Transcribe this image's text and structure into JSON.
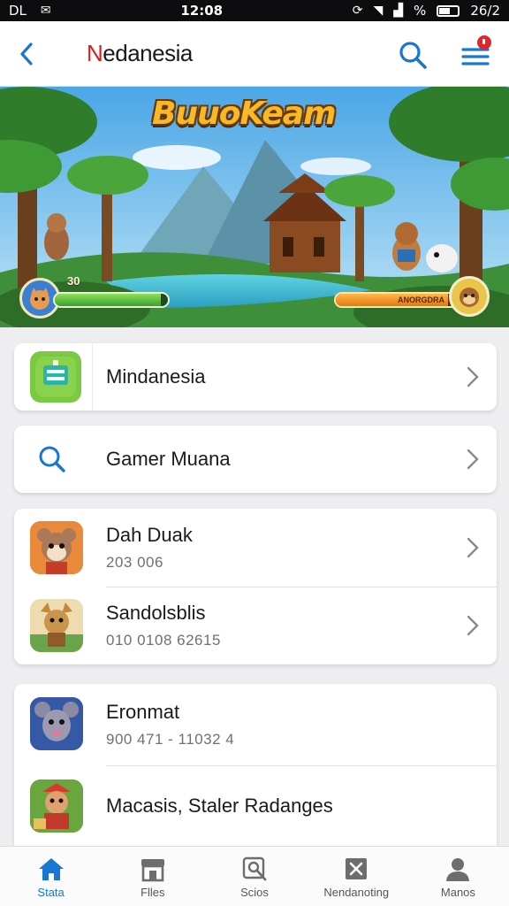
{
  "status_bar": {
    "left": [
      "DL",
      "✉"
    ],
    "time": "12:08",
    "right_text": "%",
    "battery": "26/2"
  },
  "header": {
    "title_first": "N",
    "title_rest": "edanesia",
    "back_icon": "chevron-left-icon",
    "search_icon": "search-icon",
    "menu_icon": "hamburger-menu-icon",
    "accent": "#1877d0",
    "badge_color": "#e3242b"
  },
  "hero": {
    "game_title": "BuuoKeam",
    "left_hud_value": "30",
    "left_hud_progress": 0.94,
    "right_hud_label": "ANORGDRA",
    "right_hud_progress": 0.92
  },
  "menu_card_1": {
    "label": "Mindanesia",
    "icon": "green-app-icon"
  },
  "menu_card_2": {
    "label": "Gamer Muana",
    "icon": "search-icon"
  },
  "games_card": {
    "items": [
      {
        "title": "Dah Duak",
        "subtitle": "203 006",
        "icon": "cartoon-mouse-icon"
      },
      {
        "title": "Sandolsblis",
        "subtitle": "010 0108 62615",
        "icon": "cartoon-fox-icon"
      }
    ]
  },
  "games_card_2": {
    "items": [
      {
        "title": "Eronmat",
        "subtitle": "900 471 - 11032 4",
        "icon": "cartoon-rat-icon"
      },
      {
        "title": "Macasis, Staler Radanges",
        "subtitle": "",
        "icon": "cartoon-warrior-icon"
      }
    ]
  },
  "bottom_nav": {
    "items": [
      {
        "label": "Stata",
        "icon": "home-icon",
        "active": true
      },
      {
        "label": "Flles",
        "icon": "store-icon",
        "active": false
      },
      {
        "label": "Scios",
        "icon": "search-tag-icon",
        "active": false
      },
      {
        "label": "Nendanoting",
        "icon": "cross-box-icon",
        "active": false
      },
      {
        "label": "Manos",
        "icon": "person-icon",
        "active": false
      }
    ]
  }
}
